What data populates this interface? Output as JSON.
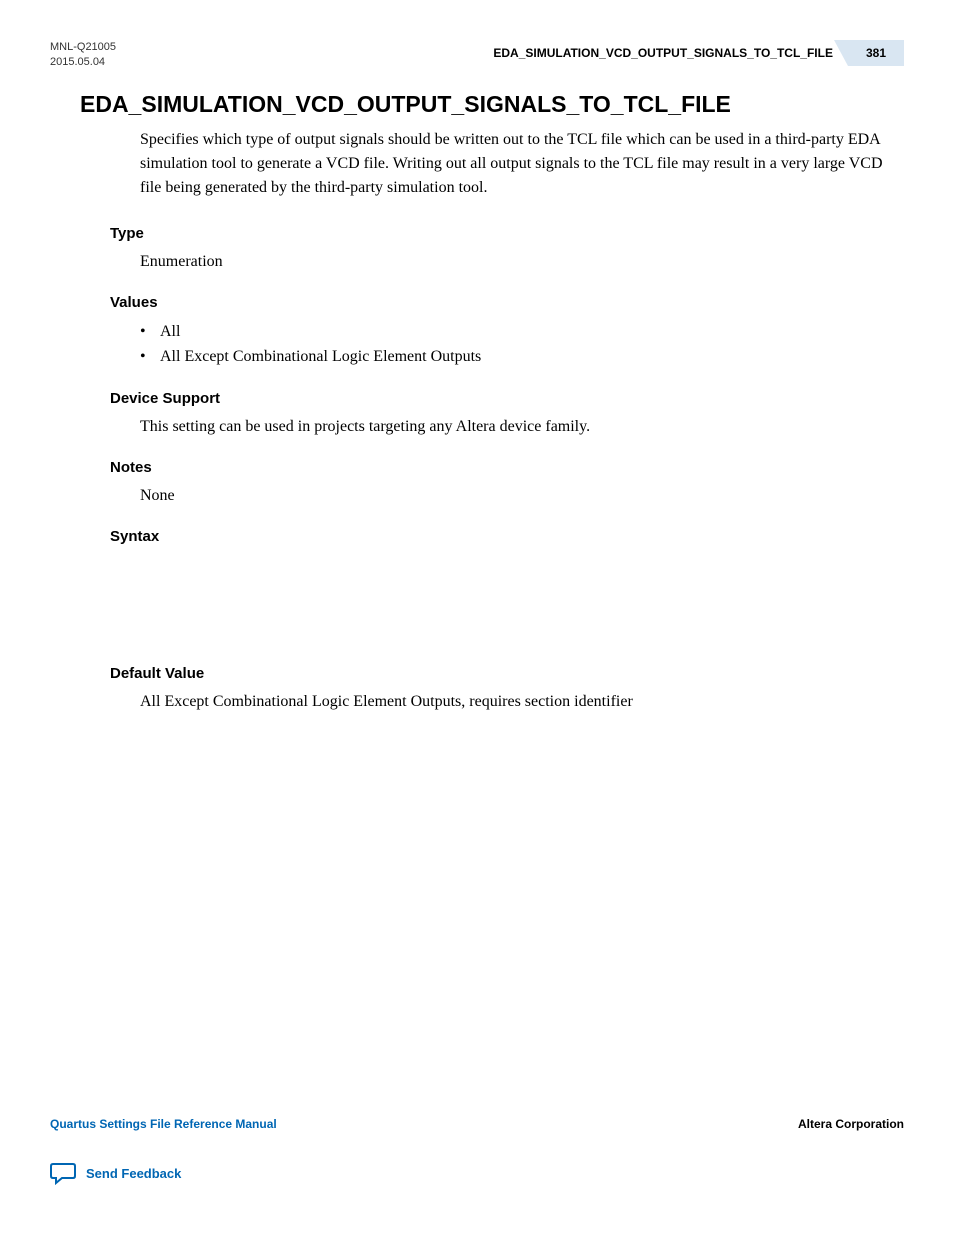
{
  "header": {
    "docId": "MNL-Q21005",
    "date": "2015.05.04",
    "title": "EDA_SIMULATION_VCD_OUTPUT_SIGNALS_TO_TCL_FILE",
    "pageNumber": "381"
  },
  "content": {
    "title": "EDA_SIMULATION_VCD_OUTPUT_SIGNALS_TO_TCL_FILE",
    "description": "Specifies which type of output signals should be written out to the TCL file which can be used in a third-party EDA simulation tool to generate a VCD file. Writing out all output signals to the TCL file may result in a very large VCD file being generated by the third-party simulation tool.",
    "sections": {
      "type": {
        "heading": "Type",
        "value": "Enumeration"
      },
      "values": {
        "heading": "Values",
        "items": [
          "All",
          "All Except Combinational Logic Element Outputs"
        ]
      },
      "deviceSupport": {
        "heading": "Device Support",
        "value": "This setting can be used in projects targeting any Altera device family."
      },
      "notes": {
        "heading": "Notes",
        "value": "None"
      },
      "syntax": {
        "heading": "Syntax"
      },
      "defaultValue": {
        "heading": "Default Value",
        "value": "All Except Combinational Logic Element Outputs, requires section identifier"
      }
    }
  },
  "footer": {
    "manualTitle": "Quartus Settings File Reference Manual",
    "company": "Altera Corporation",
    "feedbackLabel": "Send Feedback"
  }
}
